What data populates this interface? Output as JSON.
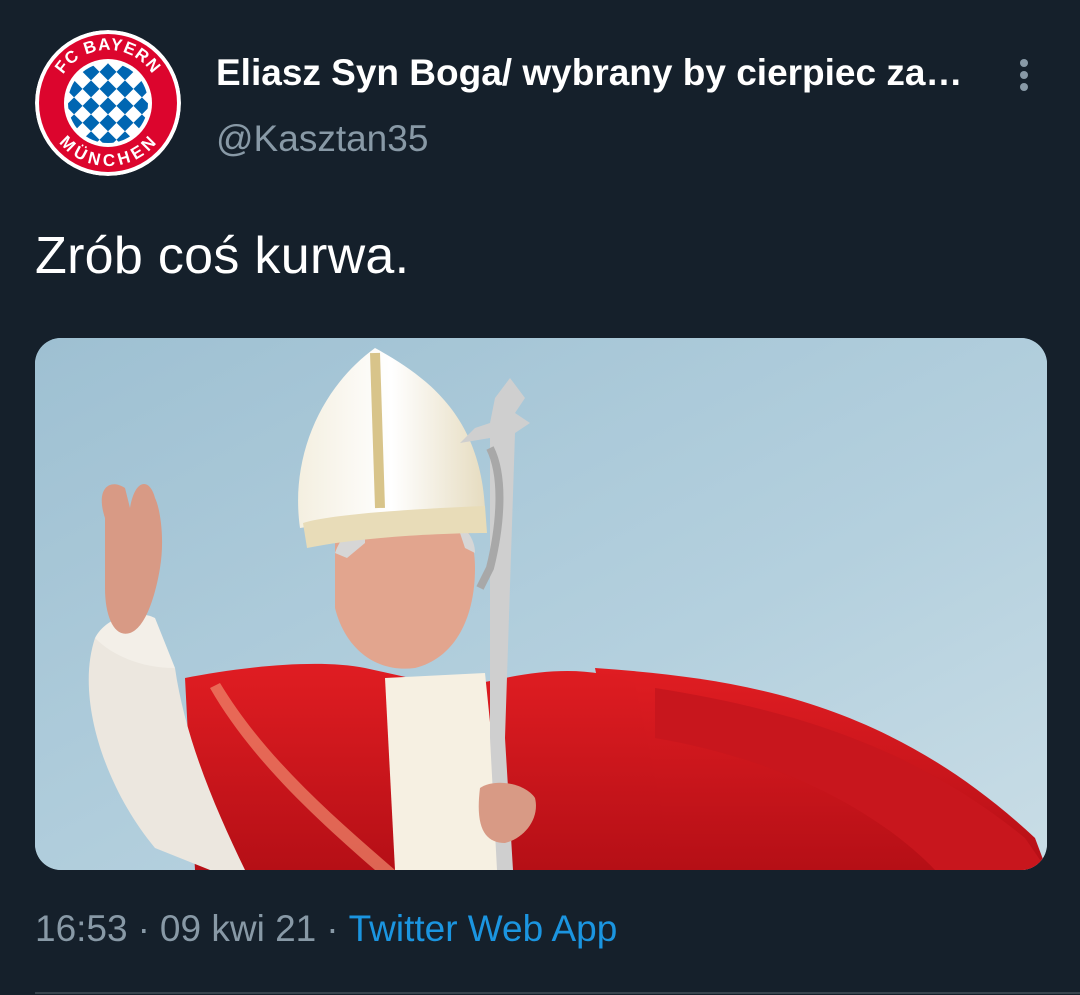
{
  "tweet": {
    "avatar": {
      "icon": "fc-bayern-munchen-logo",
      "logo_text_top": "FC BAYERN",
      "logo_text_bottom": "MÜNCHEN"
    },
    "display_name": "Eliasz Syn Boga/ wybrany by cierpiec za…",
    "handle": "@Kasztan35",
    "more_icon": "more-vertical-icon",
    "text": "Zrób coś kurwa.",
    "media": {
      "icon": "photo-pope-waving"
    },
    "time": "16:53",
    "date": "09 kwi 21",
    "separator": "·",
    "source": "Twitter Web App"
  },
  "colors": {
    "background": "#15202b",
    "primary_text": "#ffffff",
    "secondary_text": "#8899a6",
    "link": "#1b95e0",
    "divider": "#38444d",
    "bayern_red": "#dc052d",
    "bayern_blue": "#0066b2"
  }
}
